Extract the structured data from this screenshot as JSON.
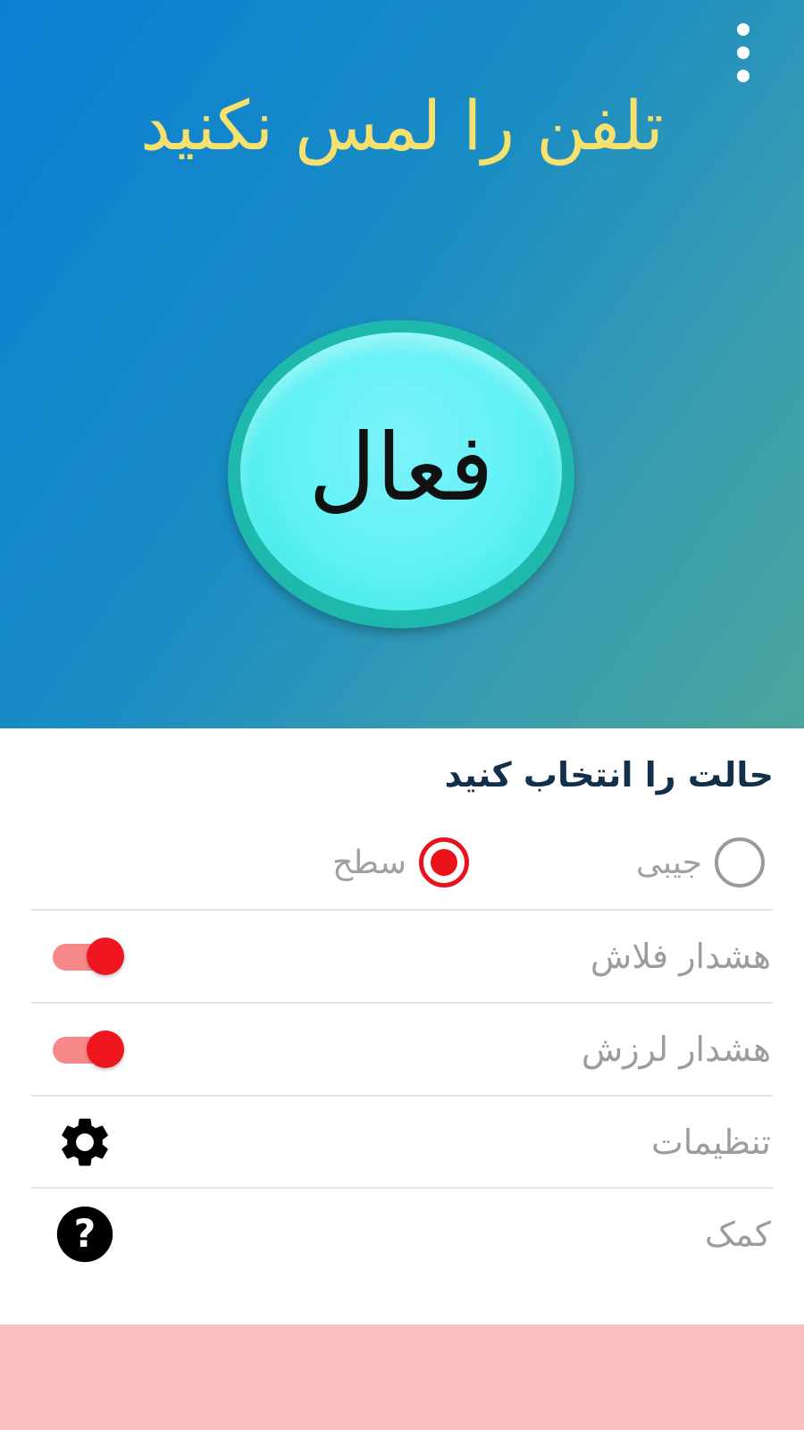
{
  "hero": {
    "title": "تلفن را لمس نکنید",
    "menu_icon": "overflow-menu-icon",
    "activate_label": "فعال",
    "title_color": "#f6e06e",
    "gradient": [
      "#0b7fd3",
      "#4aa59c"
    ]
  },
  "mode": {
    "title": "حالت را انتخاب کنید",
    "options": [
      {
        "label": "جیبی",
        "selected": false
      },
      {
        "label": "سطح",
        "selected": true
      }
    ]
  },
  "rows": {
    "flash_alert": {
      "label": "هشدار فلاش",
      "enabled": true
    },
    "vibration_alert": {
      "label": "هشدار لرزش",
      "enabled": true
    },
    "settings": {
      "label": "تنظیمات",
      "icon": "gear-icon"
    },
    "help": {
      "label": "کمک",
      "icon": "help-icon"
    }
  },
  "colors": {
    "accent_red": "#e8121b",
    "toggle_track": "#f6888a",
    "footer": "#f9bfc0"
  }
}
